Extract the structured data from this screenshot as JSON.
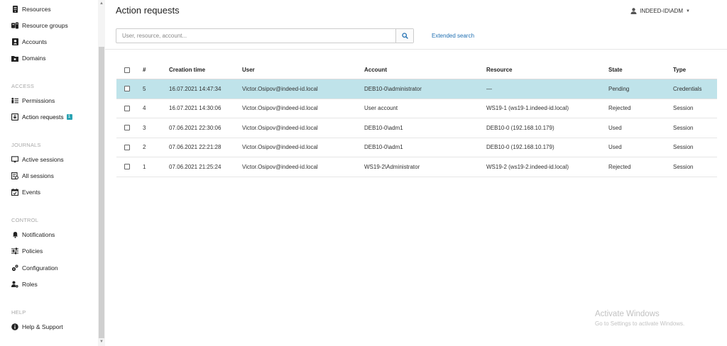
{
  "sidebar": {
    "items_top": [
      {
        "label": "Resources",
        "icon": "server-icon"
      },
      {
        "label": "Resource groups",
        "icon": "resource-groups-icon"
      },
      {
        "label": "Accounts",
        "icon": "account-card-icon"
      },
      {
        "label": "Domains",
        "icon": "folder-domain-icon"
      }
    ],
    "sections": {
      "access": "ACCESS",
      "journals": "JOURNALS",
      "control": "CONTROL",
      "help": "HELP"
    },
    "access_items": [
      {
        "label": "Permissions",
        "icon": "permissions-icon"
      },
      {
        "label": "Action requests",
        "icon": "action-requests-icon",
        "badge": "1"
      }
    ],
    "journal_items": [
      {
        "label": "Active sessions",
        "icon": "monitor-icon"
      },
      {
        "label": "All sessions",
        "icon": "sessions-list-icon"
      },
      {
        "label": "Events",
        "icon": "calendar-icon"
      }
    ],
    "control_items": [
      {
        "label": "Notifications",
        "icon": "bell-icon"
      },
      {
        "label": "Policies",
        "icon": "sliders-icon"
      },
      {
        "label": "Configuration",
        "icon": "gears-icon"
      },
      {
        "label": "Roles",
        "icon": "user-cog-icon"
      }
    ],
    "help_items": [
      {
        "label": "Help & Support",
        "icon": "info-icon"
      }
    ]
  },
  "header": {
    "title": "Action requests",
    "user": "INDEED-ID\\ADM"
  },
  "search": {
    "placeholder": "User, resource, account...",
    "value": "",
    "extended_link": "Extended search"
  },
  "table": {
    "columns": [
      "#",
      "Creation time",
      "User",
      "Account",
      "Resource",
      "State",
      "Type"
    ],
    "rows": [
      {
        "num": "5",
        "time": "16.07.2021 14:47:34",
        "user": "Victor.Osipov@indeed-id.local",
        "account": "DEB10-0\\administrator",
        "resource": "—",
        "state": "Pending",
        "type": "Credentials",
        "selected": true
      },
      {
        "num": "4",
        "time": "16.07.2021 14:30:06",
        "user": "Victor.Osipov@indeed-id.local",
        "account": "User account",
        "resource": "WS19-1 (ws19-1.indeed-id.local)",
        "state": "Rejected",
        "type": "Session"
      },
      {
        "num": "3",
        "time": "07.06.2021 22:30:06",
        "user": "Victor.Osipov@indeed-id.local",
        "account": "DEB10-0\\adm1",
        "resource": "DEB10-0 (192.168.10.179)",
        "state": "Used",
        "type": "Session"
      },
      {
        "num": "2",
        "time": "07.06.2021 22:21:28",
        "user": "Victor.Osipov@indeed-id.local",
        "account": "DEB10-0\\adm1",
        "resource": "DEB10-0 (192.168.10.179)",
        "state": "Used",
        "type": "Session"
      },
      {
        "num": "1",
        "time": "07.06.2021 21:25:24",
        "user": "Victor.Osipov@indeed-id.local",
        "account": "WS19-2\\Administrator",
        "resource": "WS19-2 (ws19-2.indeed-id.local)",
        "state": "Rejected",
        "type": "Session"
      }
    ]
  },
  "watermark": {
    "line1": "Activate Windows",
    "line2": "Go to Settings to activate Windows."
  },
  "colors": {
    "selected_row": "#bfe3ea",
    "badge": "#2aa3b3",
    "link": "#1f6fb2"
  }
}
